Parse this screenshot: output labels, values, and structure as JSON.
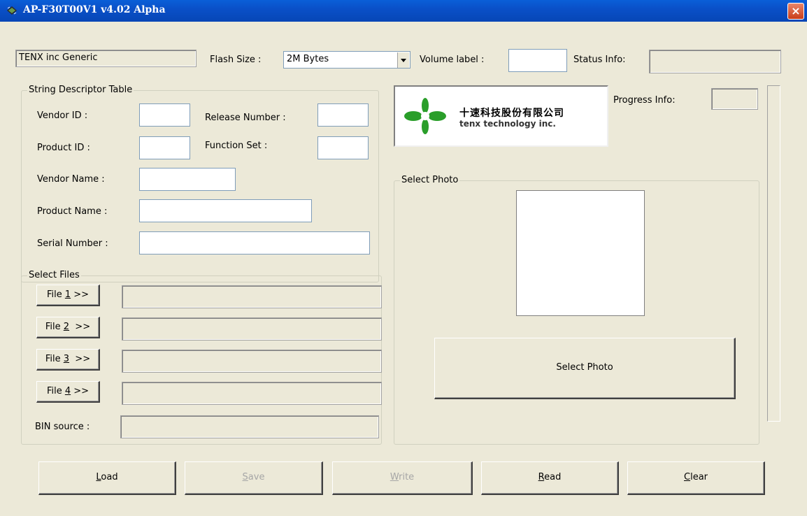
{
  "window": {
    "title": "AP-F30T00V1 v4.02 Alpha",
    "close_label": "×"
  },
  "header": {
    "device_name": "TENX inc Generic",
    "flash_size_label": "Flash Size :",
    "flash_size_value": "2M Bytes",
    "volume_label_label": "Volume label :",
    "volume_label_value": "",
    "status_info_label": "Status Info:",
    "status_info_value": ""
  },
  "descriptor": {
    "group_label": "String Descriptor Table",
    "vendor_id_label": "Vendor ID :",
    "release_number_label": "Release Number :",
    "product_id_label": "Product ID :",
    "function_set_label": "Function Set :",
    "vendor_name_label": "Vendor Name :",
    "product_name_label": "Product Name :",
    "serial_number_label": "Serial Number :"
  },
  "logo": {
    "line1": "十速科技股份有限公司",
    "line2": "tenx technology inc."
  },
  "progress": {
    "label": "Progress Info:",
    "value": ""
  },
  "files": {
    "group_label": "Select Files",
    "buttons": [
      {
        "pre": "File ",
        "key": "1",
        "post": " >>"
      },
      {
        "pre": "File ",
        "key": "2",
        "post": "  >>"
      },
      {
        "pre": "File ",
        "key": "3",
        "post": "  >>"
      },
      {
        "pre": "File ",
        "key": "4",
        "post": " >>"
      }
    ],
    "bin_source_label": "BIN source :"
  },
  "photo": {
    "group_label": "Select Photo",
    "button_label": "Select Photo"
  },
  "actions": [
    {
      "key": "L",
      "rest": "oad",
      "enabled": true
    },
    {
      "key": "S",
      "rest": "ave",
      "enabled": false
    },
    {
      "key": "W",
      "rest": "rite",
      "enabled": false
    },
    {
      "key": "R",
      "rest": "ead",
      "enabled": true
    },
    {
      "key": "C",
      "rest": "lear",
      "enabled": true
    }
  ]
}
